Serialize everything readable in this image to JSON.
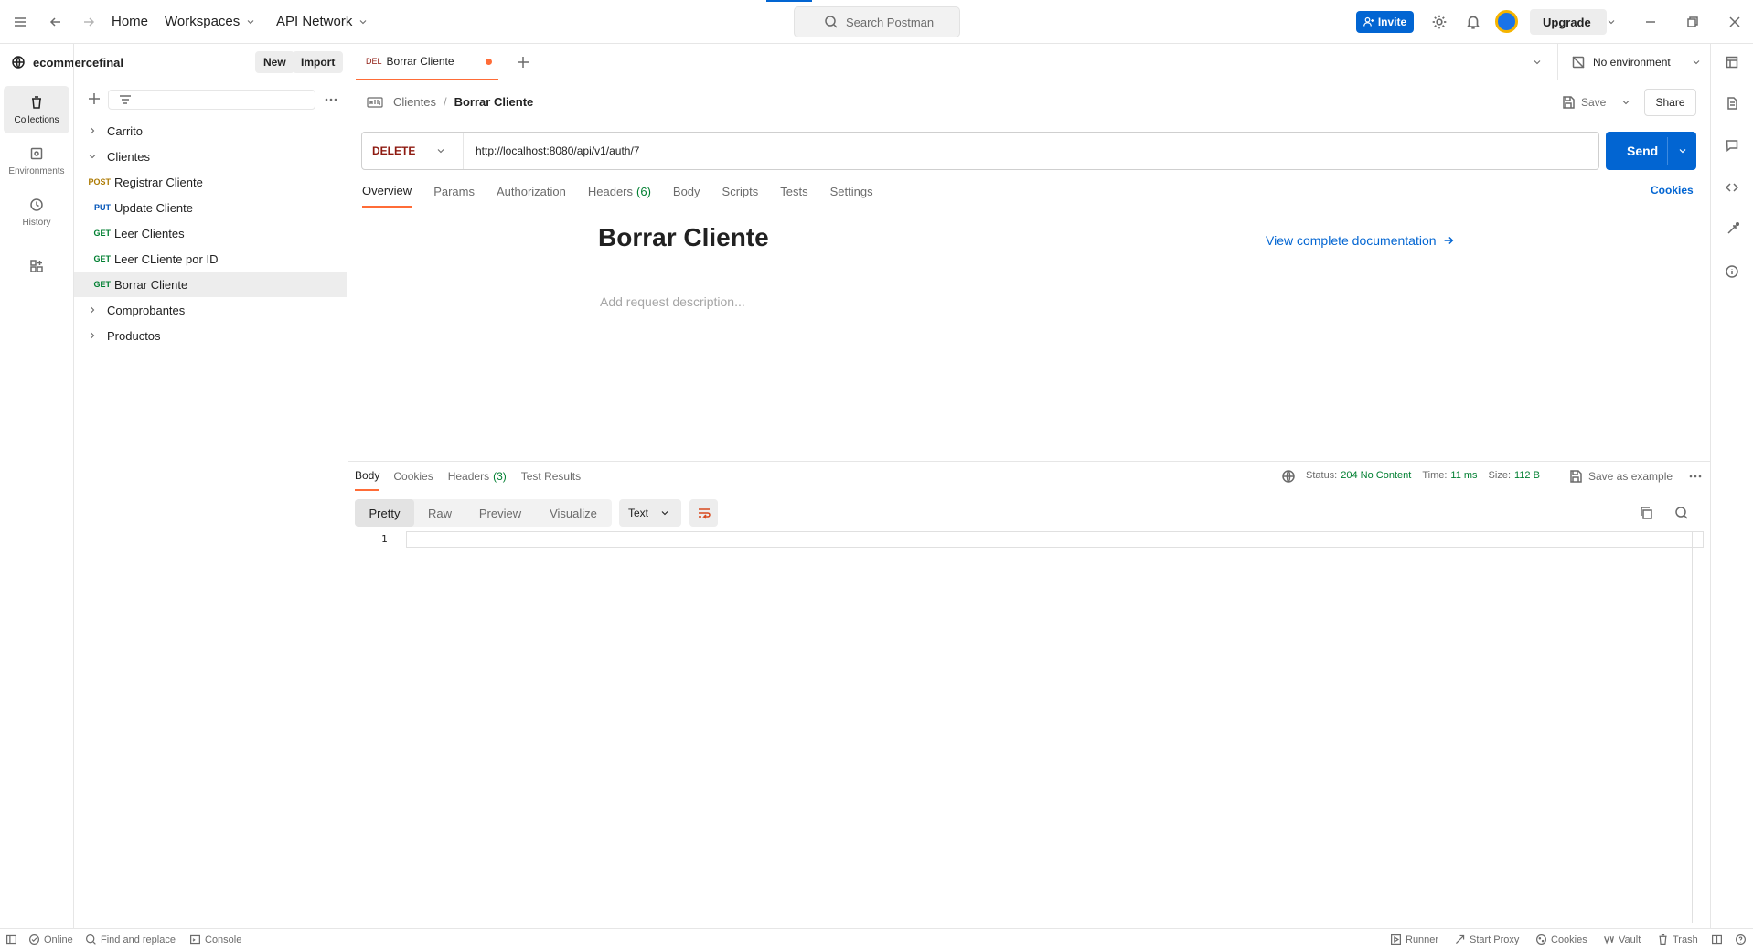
{
  "topbar": {
    "home": "Home",
    "workspaces": "Workspaces",
    "api_network": "API Network",
    "search_placeholder": "Search Postman",
    "invite": "Invite",
    "upgrade": "Upgrade"
  },
  "workspace": {
    "name": "ecommercefinal",
    "new_label": "New",
    "import_label": "Import"
  },
  "rail": {
    "collections": "Collections",
    "environments": "Environments",
    "history": "History"
  },
  "sidebar": {
    "folders": [
      {
        "label": "Carrito"
      },
      {
        "label": "Clientes"
      },
      {
        "label": "Comprobantes"
      },
      {
        "label": "Productos"
      }
    ],
    "requests": [
      {
        "method": "POST",
        "label": "Registrar Cliente",
        "color": "#ad7a03"
      },
      {
        "method": "PUT",
        "label": "Update Cliente",
        "color": "#0053b8"
      },
      {
        "method": "GET",
        "label": "Leer Clientes",
        "color": "#007f31"
      },
      {
        "method": "GET",
        "label": "Leer CLiente por ID",
        "color": "#007f31"
      },
      {
        "method": "GET",
        "label": "Borrar Cliente",
        "color": "#007f31"
      }
    ]
  },
  "tab": {
    "method": "DEL",
    "label": "Borrar Cliente",
    "environment": "No environment"
  },
  "request": {
    "breadcrumb_parent": "Clientes",
    "breadcrumb_current": "Borrar Cliente",
    "save": "Save",
    "share": "Share",
    "method": "DELETE",
    "url": "http://localhost:8080/api/v1/auth/7",
    "send": "Send",
    "tabs": [
      "Overview",
      "Params",
      "Authorization",
      "Headers",
      "Body",
      "Scripts",
      "Tests",
      "Settings"
    ],
    "headers_count": "(6)",
    "cookies": "Cookies",
    "title": "Borrar Cliente",
    "doc_link": "View complete documentation",
    "description_placeholder": "Add request description..."
  },
  "response": {
    "tabs": [
      "Body",
      "Cookies",
      "Headers",
      "Test Results"
    ],
    "headers_count": "(3)",
    "status_label": "Status:",
    "status_value": "204 No Content",
    "time_label": "Time:",
    "time_value": "11 ms",
    "size_label": "Size:",
    "size_value": "112 B",
    "save_example": "Save as example",
    "views": [
      "Pretty",
      "Raw",
      "Preview",
      "Visualize"
    ],
    "format": "Text",
    "line_number": "1"
  },
  "statusbar": {
    "online": "Online",
    "find_replace": "Find and replace",
    "console": "Console",
    "runner": "Runner",
    "start_proxy": "Start Proxy",
    "cookies": "Cookies",
    "vault": "Vault",
    "trash": "Trash"
  },
  "colors": {
    "accent": "#ff6c37",
    "primary": "#0265d2",
    "delete": "#8e1a10",
    "success": "#007f31"
  }
}
